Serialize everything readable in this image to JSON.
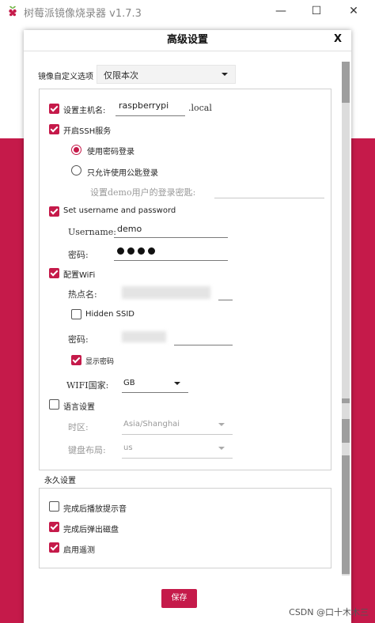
{
  "window": {
    "title": "树莓派镜像烧录器 v1.7.3"
  },
  "dialog": {
    "title": "高级设置",
    "close_label": "X",
    "image_options_label": "镜像自定义选项",
    "image_options_value": "仅限本次",
    "hostname": {
      "label": "设置主机名:",
      "value": "raspberrypi",
      "suffix": ".local",
      "checked": true
    },
    "ssh": {
      "label": "开启SSH服务",
      "checked": true,
      "password_option": "使用密码登录",
      "password_selected": true,
      "pubkey_option": "只允许使用公匙登录",
      "key_label": "设置demo用户的登录密匙:"
    },
    "user": {
      "label": "Set username and password",
      "checked": true,
      "username_label": "Username:",
      "username_value": "demo",
      "password_label": "密码:"
    },
    "wifi": {
      "label": "配置WiFi",
      "checked": true,
      "ssid_label": "热点名:",
      "hidden_ssid_label": "Hidden SSID",
      "hidden_ssid_checked": false,
      "password_label": "密码:",
      "show_password_label": "显示密码",
      "show_password_checked": true,
      "country_label": "WIFI国家:",
      "country_value": "GB"
    },
    "locale": {
      "label": "语言设置",
      "checked": false,
      "timezone_label": "时区:",
      "timezone_value": "Asia/Shanghai",
      "keyboard_label": "键盘布局:",
      "keyboard_value": "us"
    },
    "persistent": {
      "section_label": "永久设置",
      "beep_label": "完成后播放提示音",
      "beep_checked": false,
      "eject_label": "完成后弹出磁盘",
      "eject_checked": true,
      "telemetry_label": "启用遥测",
      "telemetry_checked": true
    },
    "save_label": "保存"
  },
  "watermark": "CSDN @口十木木三",
  "colors": {
    "accent": "#c51a4a"
  }
}
